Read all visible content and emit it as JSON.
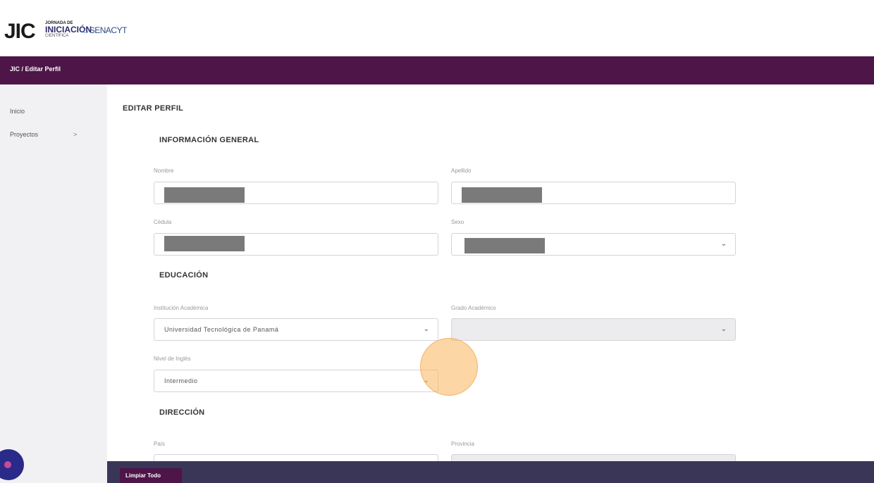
{
  "header": {
    "logo_main": "JIC",
    "logo_line1": "JORNADA DE",
    "logo_line2": "INICIACIÓN",
    "logo_line3": "CIENTÍFICA",
    "logo_partner": "SENACYT"
  },
  "breadcrumb": "JIC / Editar Perfil",
  "sidebar": {
    "items": [
      {
        "label": "Inicio"
      },
      {
        "label": "Proyectos",
        "chevron": ">"
      }
    ]
  },
  "page": {
    "title": "EDITAR PERFIL",
    "sections": {
      "general": "INFORMACIÓN GENERAL",
      "education": "EDUCACIÓN",
      "address": "DIRECCIÓN"
    }
  },
  "form": {
    "nombre": {
      "label": "Nombre",
      "value": ""
    },
    "apellido": {
      "label": "Apellido",
      "value": ""
    },
    "cedula": {
      "label": "Cédula",
      "value": ""
    },
    "sexo": {
      "label": "Sexo",
      "value": ""
    },
    "institucion": {
      "label": "Institución Académica",
      "value": "Universidad Tecnológica de Panamá"
    },
    "grado": {
      "label": "Grado Académico",
      "value": ""
    },
    "ingles": {
      "label": "Nivel de Inglés",
      "value": "Intermedio"
    },
    "pais": {
      "label": "País",
      "value": ""
    },
    "provincia": {
      "label": "Provincia",
      "value": ""
    }
  },
  "footer": {
    "clear_label": "Limpiar Todo"
  },
  "colors": {
    "primary": "#4e1549",
    "footer": "#3a3658",
    "highlight": "#fab45a"
  }
}
